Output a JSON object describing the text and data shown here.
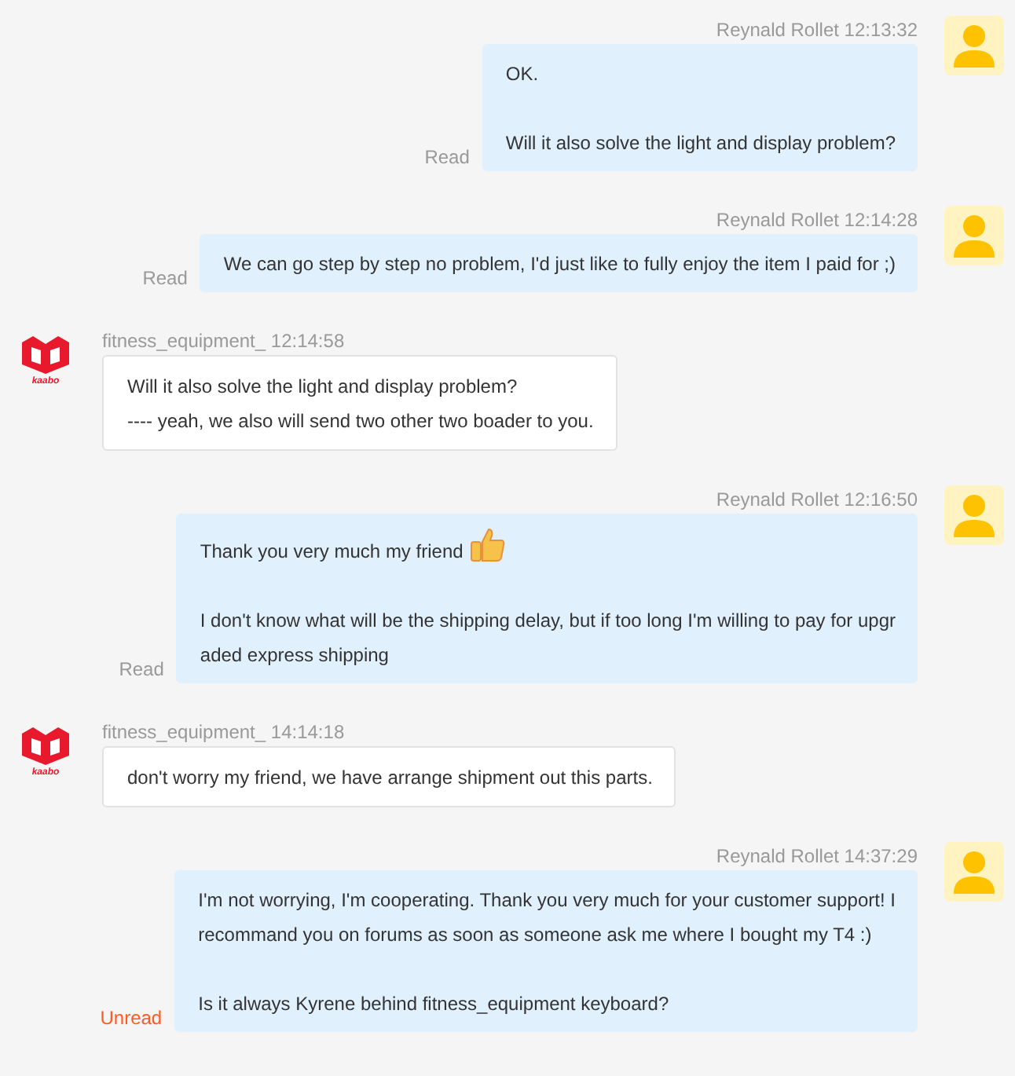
{
  "messages": [
    {
      "kind": "sent",
      "sender": "Reynald Rollet",
      "time": "12:13:32",
      "status": {
        "text": "Read",
        "read": true
      },
      "paragraphs": [
        {
          "lines": [
            "OK."
          ]
        },
        {
          "lines": [
            "Will it also solve the light and display problem?"
          ]
        }
      ]
    },
    {
      "kind": "sent",
      "sender": "Reynald Rollet",
      "time": "12:14:28",
      "status": {
        "text": "Read",
        "read": true
      },
      "paragraphs": [
        {
          "lines": [
            "We can go step by step no problem, I'd just like to fully enjoy the item I paid for ;)"
          ]
        }
      ]
    },
    {
      "kind": "received",
      "sender": "fitness_equipment_",
      "time": "12:14:58",
      "logo_text": "kaabo",
      "paragraphs": [
        {
          "lines": [
            "Will it also solve the light and display problem?",
            "---- yeah, we also will send two other two boader to you."
          ]
        }
      ]
    },
    {
      "kind": "sent",
      "sender": "Reynald Rollet",
      "time": "12:16:50",
      "status": {
        "text": "Read",
        "read": true
      },
      "paragraphs": [
        {
          "kind": "emoji",
          "lines": [
            "Thank you very much my friend"
          ]
        },
        {
          "lines": [
            "I don't know what will be the shipping delay, but if too long I'm willing to pay for upgr",
            "aded express shipping"
          ]
        }
      ]
    },
    {
      "kind": "received",
      "sender": "fitness_equipment_",
      "time": "14:14:18",
      "logo_text": "kaabo",
      "paragraphs": [
        {
          "lines": [
            "don't worry my friend, we have arrange shipment out this parts."
          ]
        }
      ]
    },
    {
      "kind": "sent",
      "sender": "Reynald Rollet",
      "time": "14:37:29",
      "status": {
        "text": "Unread",
        "read": false
      },
      "paragraphs": [
        {
          "lines": [
            "I'm not worrying, I'm cooperating. Thank you very much for your customer support! I",
            "recommand you on forums as soon as someone ask me where I bought my T4 :)"
          ]
        },
        {
          "lines": [
            "Is it always Kyrene behind fitness_equipment keyboard?"
          ]
        }
      ]
    }
  ]
}
